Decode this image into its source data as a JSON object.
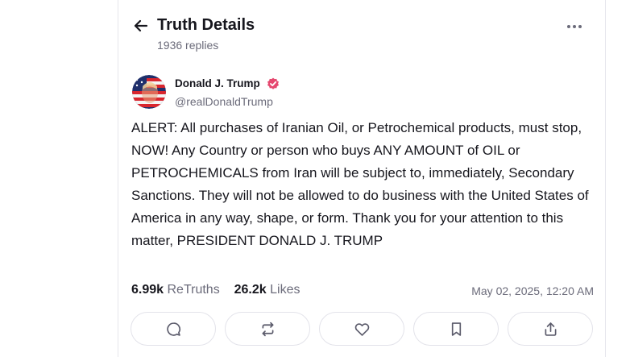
{
  "header": {
    "title": "Truth Details",
    "subtitle": "1936 replies"
  },
  "icons": {
    "back": "arrow-left-icon",
    "more": "ellipsis-icon",
    "verified": "verified-badge-icon",
    "reply": "reply-icon",
    "retruth": "retruth-icon",
    "like": "heart-icon",
    "bookmark": "bookmark-icon",
    "share": "share-icon"
  },
  "post": {
    "author_name": "Donald J. Trump",
    "author_handle": "@realDonaldTrump",
    "text": "ALERT: All purchases of Iranian Oil, or Petrochemical products, must stop, NOW! Any Country or person who buys ANY AMOUNT of OIL or PETROCHEMICALS from Iran will be subject to, immediately, Secondary Sanctions. They will not be allowed to do business with the United States of America in any way, shape, or form. Thank you for your attention to this matter, PRESIDENT DONALD J. TRUMP",
    "retruths_count": "6.99k",
    "retruths_label": "ReTruths",
    "likes_count": "26.2k",
    "likes_label": "Likes",
    "timestamp": "May 02, 2025, 12:20 AM"
  },
  "colors": {
    "verified": "#e5486f",
    "text": "#16161d",
    "muted": "#6b6b7a",
    "border": "#e3e3ea"
  }
}
